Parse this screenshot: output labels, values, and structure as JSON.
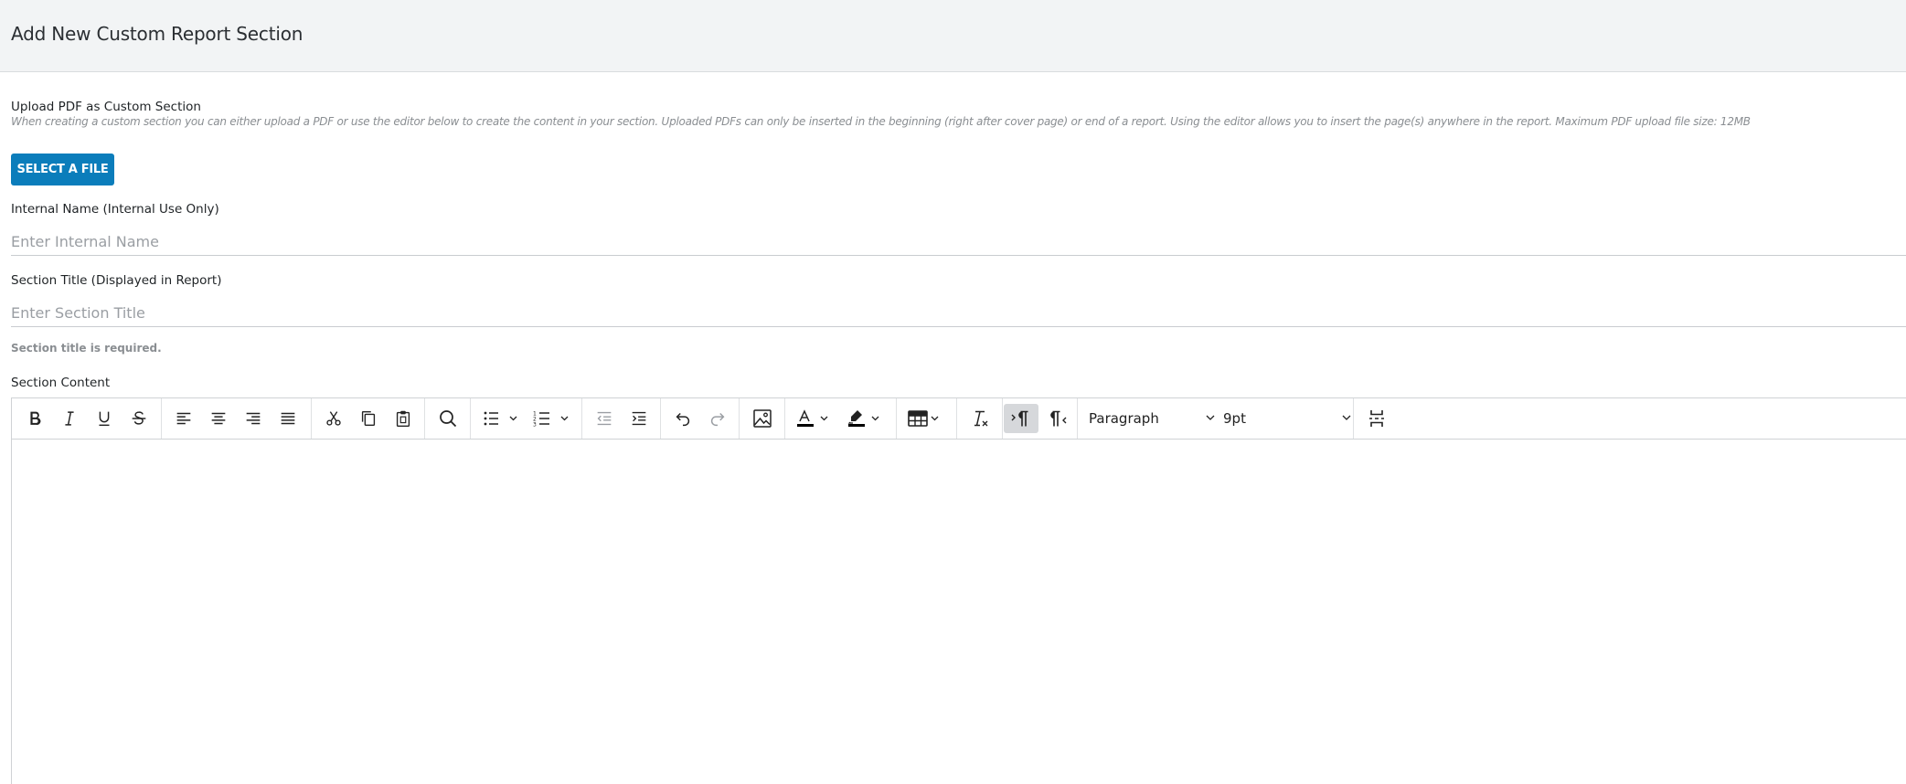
{
  "header": {
    "title": "Add New Custom Report Section"
  },
  "upload": {
    "label": "Upload PDF as Custom Section",
    "hint": "When creating a custom section you can either upload a PDF or use the editor below to create the content in your section. Uploaded PDFs can only be inserted in the beginning (right after cover page) or end of a report. Using the editor allows you to insert the page(s) anywhere in the report. Maximum PDF upload file size: 12MB",
    "button_label": "SELECT A FILE"
  },
  "internal_name": {
    "label": "Internal Name (Internal Use Only)",
    "value": "",
    "placeholder": "Enter Internal Name"
  },
  "section_title": {
    "label": "Section Title (Displayed in Report)",
    "value": "",
    "placeholder": "Enter Section Title",
    "error": "Section title is required."
  },
  "section_content": {
    "label": "Section Content"
  },
  "toolbar": {
    "block_format": "Paragraph",
    "font_size": "9pt",
    "icons": [
      "bold-icon",
      "italic-icon",
      "underline-icon",
      "strikethrough-icon",
      "align-left-icon",
      "align-center-icon",
      "align-right-icon",
      "align-justify-icon",
      "cut-icon",
      "copy-icon",
      "paste-icon",
      "search-replace-icon",
      "bullet-list-icon",
      "numbered-list-icon",
      "outdent-icon",
      "indent-icon",
      "undo-icon",
      "redo-icon",
      "image-icon",
      "text-color-icon",
      "highlight-color-icon",
      "table-icon",
      "clear-formatting-icon",
      "ltr-icon",
      "rtl-icon",
      "page-break-icon"
    ]
  },
  "colors": {
    "accent": "#0b7dbb",
    "header_bg": "#f2f4f5",
    "text_color_bar": "#000000"
  }
}
